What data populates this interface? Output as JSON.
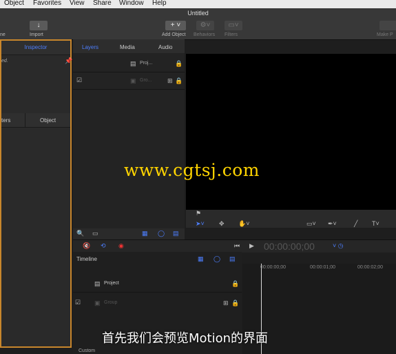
{
  "menu": [
    "Object",
    "Favorites",
    "View",
    "Share",
    "Window",
    "Help"
  ],
  "window": {
    "title": "Untitled"
  },
  "toolbar": {
    "left_partial": "ne",
    "import": "Import",
    "add_object": "Add Object",
    "behaviors": "Behaviors",
    "filters": "Filters",
    "make_partial": "Make P"
  },
  "inspector": {
    "title": "Inspector",
    "note_partial": "ed.",
    "tabs": [
      "ters",
      "Object"
    ]
  },
  "layers": {
    "tabs": [
      "Layers",
      "Media",
      "Audio"
    ],
    "items": [
      {
        "label": "Proj..."
      },
      {
        "label": "Gro..."
      }
    ]
  },
  "transport": {
    "timecode": "00:00:00;00"
  },
  "timeline": {
    "title": "Timeline",
    "items": [
      "Project",
      "Group"
    ],
    "ruler": [
      "00:00:00;00",
      "00:00:01;00",
      "00:00:02;00"
    ],
    "footer": "Custom"
  },
  "overlay": {
    "watermark": "www.cgtsj.com",
    "subtitle": "首先我们会预览Motion的界面"
  },
  "colors": {
    "accent": "#4d7fff",
    "highlight": "#c8862c",
    "watermark": "#ffd400"
  }
}
